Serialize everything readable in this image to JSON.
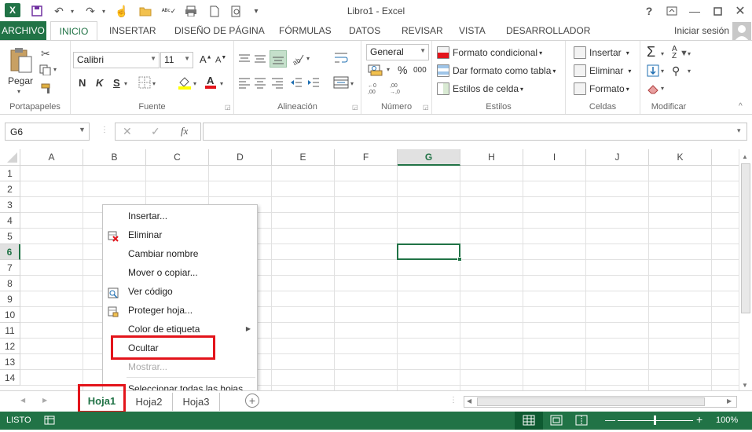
{
  "window": {
    "title": "Libro1 - Excel"
  },
  "menu_tabs": [
    "ARCHIVO",
    "INICIO",
    "INSERTAR",
    "DISEÑO DE PÁGINA",
    "FÓRMULAS",
    "DATOS",
    "REVISAR",
    "VISTA",
    "DESARROLLADOR"
  ],
  "account": {
    "signin": "Iniciar sesión"
  },
  "ribbon": {
    "clipboard": {
      "paste": "Pegar",
      "label": "Portapapeles"
    },
    "font": {
      "name": "Calibri",
      "size": "11",
      "bold": "N",
      "italic": "K",
      "underline": "S",
      "label": "Fuente"
    },
    "alignment": {
      "label": "Alineación"
    },
    "number": {
      "format": "General",
      "percent": "%",
      "thousands": "000",
      "label": "Número"
    },
    "styles": {
      "conditional": "Formato condicional",
      "as_table": "Dar formato como tabla",
      "cell_styles": "Estilos de celda",
      "label": "Estilos"
    },
    "cells": {
      "insert": "Insertar",
      "delete": "Eliminar",
      "format": "Formato",
      "label": "Celdas"
    },
    "editing": {
      "label": "Modificar"
    }
  },
  "formula_bar": {
    "name_box": "G6",
    "fx": "fx",
    "value": ""
  },
  "grid": {
    "columns": [
      "A",
      "B",
      "C",
      "D",
      "E",
      "F",
      "G",
      "H",
      "I",
      "J",
      "K"
    ],
    "rows": [
      "1",
      "2",
      "3",
      "4",
      "5",
      "6",
      "7",
      "8",
      "9",
      "10",
      "11",
      "12",
      "13",
      "14"
    ],
    "selected_cell": "G6"
  },
  "context_menu": {
    "items": [
      {
        "label": "Insertar...",
        "icon": "",
        "disabled": false
      },
      {
        "label": "Eliminar",
        "icon": "delete-sheet-icon",
        "disabled": false
      },
      {
        "label": "Cambiar nombre",
        "icon": "",
        "disabled": false
      },
      {
        "label": "Mover o copiar...",
        "icon": "",
        "disabled": false
      },
      {
        "label": "Ver código",
        "icon": "view-code-icon",
        "disabled": false
      },
      {
        "label": "Proteger hoja...",
        "icon": "protect-sheet-icon",
        "disabled": false
      },
      {
        "label": "Color de etiqueta",
        "icon": "",
        "disabled": false,
        "submenu": true
      },
      {
        "label": "Ocultar",
        "icon": "",
        "disabled": false,
        "highlighted": true
      },
      {
        "label": "Mostrar...",
        "icon": "",
        "disabled": true
      },
      {
        "label": "Seleccionar todas las hojas",
        "icon": "",
        "disabled": false
      }
    ]
  },
  "sheets": {
    "tabs": [
      "Hoja1",
      "Hoja2",
      "Hoja3"
    ],
    "active": "Hoja1"
  },
  "status": {
    "mode": "LISTO",
    "zoom": "100%"
  },
  "colors": {
    "excel_green": "#217346",
    "highlight_red": "#e3141b",
    "selected_header": "#217346"
  }
}
